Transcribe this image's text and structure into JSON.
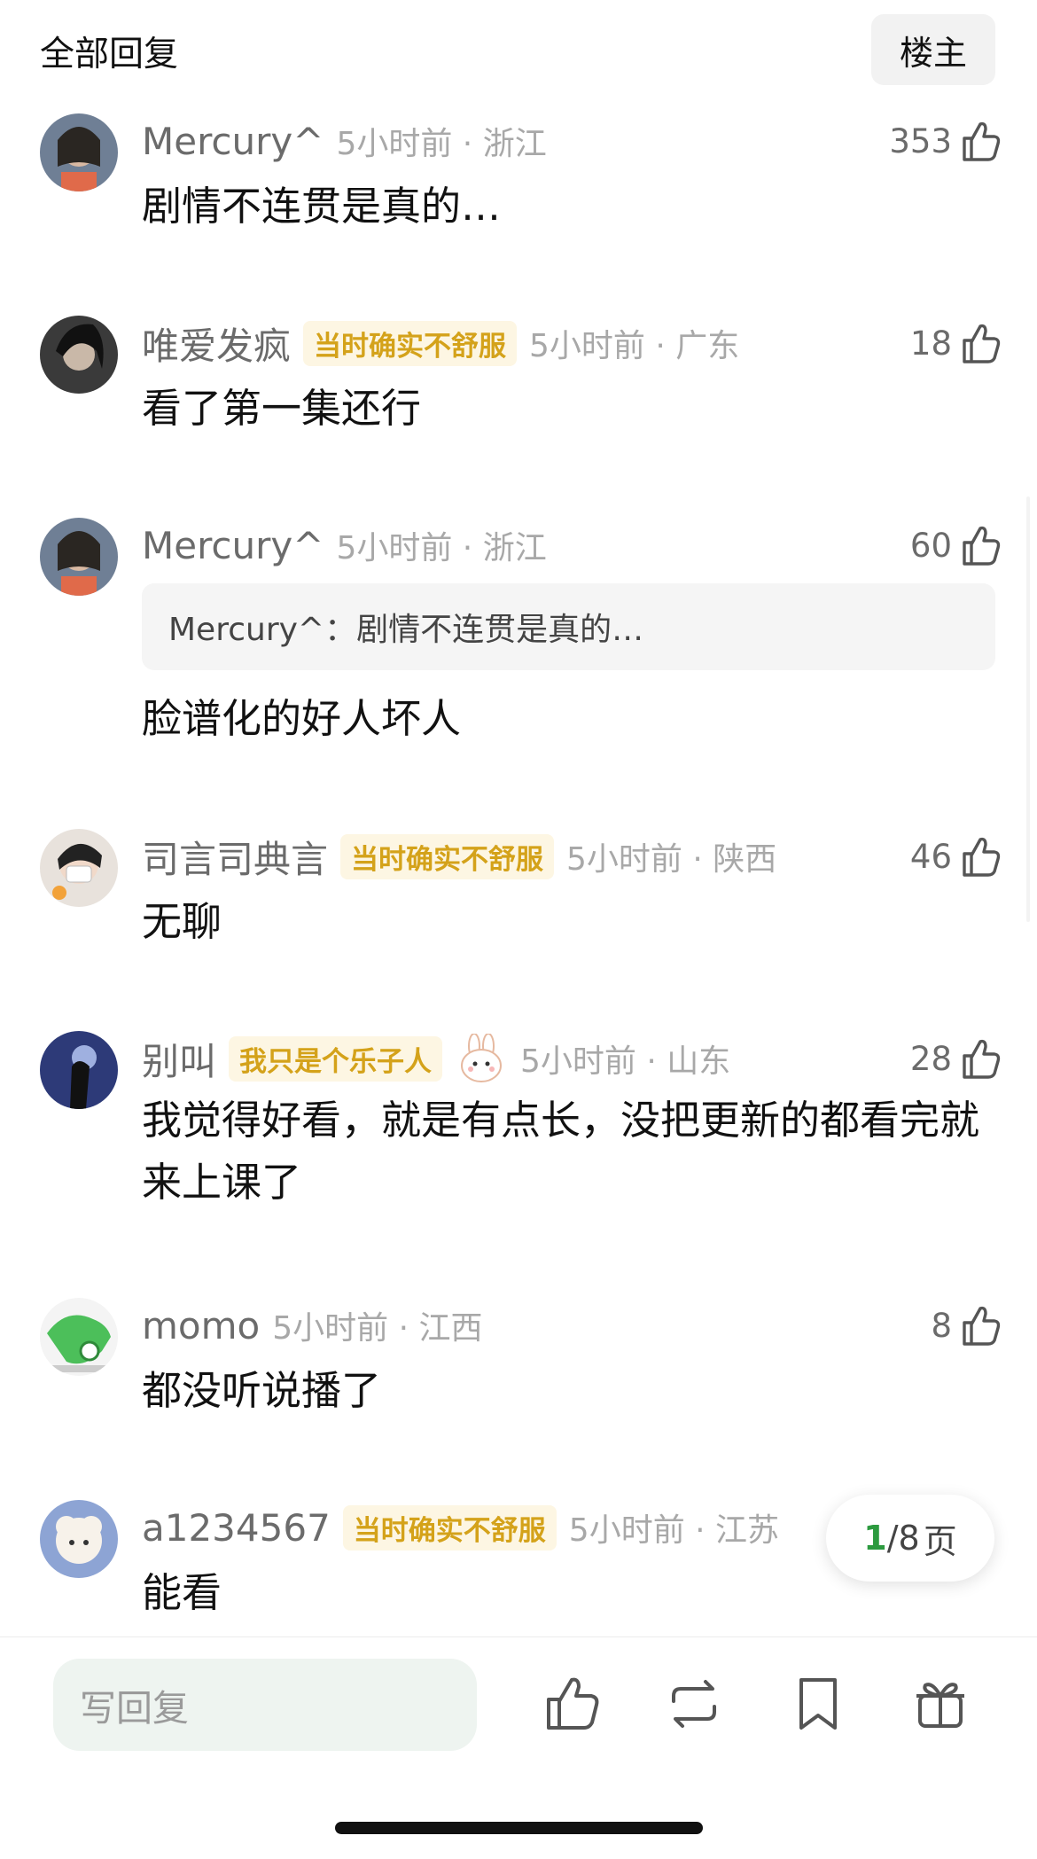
{
  "header": {
    "title": "全部回复",
    "louzhu_label": "楼主"
  },
  "comments": [
    {
      "name": "Mercury^",
      "badge": "",
      "time": "5小时前 · 浙江",
      "likes": "353",
      "quote": "",
      "text": "剧情不连贯是真的…"
    },
    {
      "name": "唯爱发疯",
      "badge": "当时确实不舒服",
      "time": "5小时前 · 广东",
      "likes": "18",
      "quote": "",
      "text": "看了第一集还行"
    },
    {
      "name": "Mercury^",
      "badge": "",
      "time": "5小时前 · 浙江",
      "likes": "60",
      "quote": "Mercury^：剧情不连贯是真的…",
      "text": "脸谱化的好人坏人"
    },
    {
      "name": "司言司典言",
      "badge": "当时确实不舒服",
      "time": "5小时前 · 陕西",
      "likes": "46",
      "quote": "",
      "text": "无聊"
    },
    {
      "name": "别叫",
      "badge": "我只是个乐子人",
      "sticker": "bunny-sticker",
      "time": "5小时前 · 山东",
      "likes": "28",
      "quote": "",
      "text": "我觉得好看，就是有点长，没把更新的都看完就来上课了"
    },
    {
      "name": "momo",
      "badge": "",
      "time": "5小时前 · 江西",
      "likes": "8",
      "quote": "",
      "text": "都没听说播了"
    },
    {
      "name": "a1234567",
      "badge": "当时确实不舒服",
      "time": "5小时前 · 江苏",
      "likes": "",
      "quote": "",
      "text": "能看"
    }
  ],
  "pager": {
    "current": "1",
    "total": "/8",
    "unit": "页"
  },
  "bottom_bar": {
    "reply_placeholder": "写回复"
  },
  "colors": {
    "badge_text": "#d4a21a",
    "badge_bg": "#fdf6e3",
    "pager_accent": "#2c9a3f",
    "reply_bg": "#eef4f0"
  }
}
